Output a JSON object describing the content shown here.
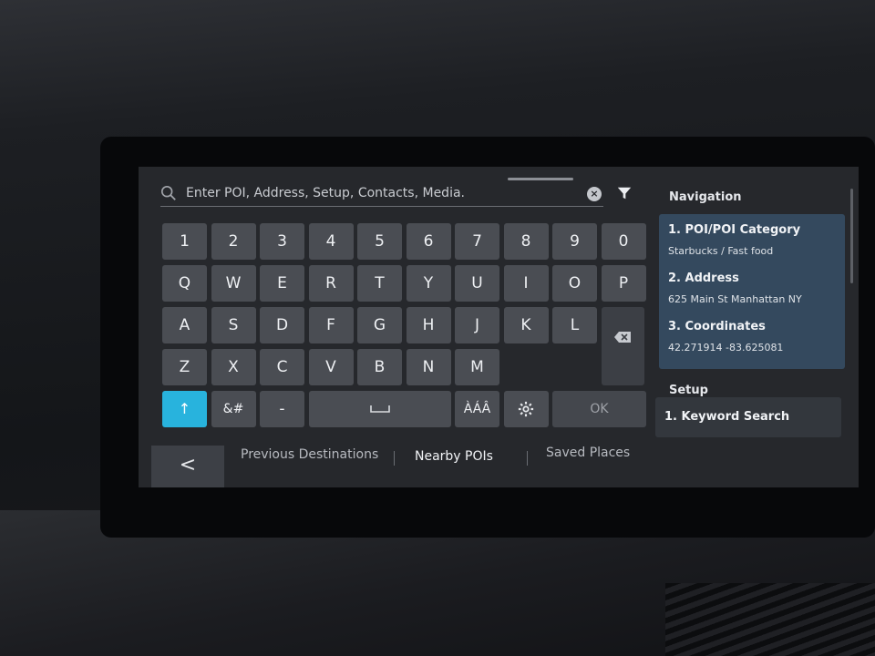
{
  "search": {
    "placeholder": "Enter POI, Address, Setup, Contacts, Media."
  },
  "icons": {
    "search": "search-icon",
    "clear": "clear-circle-icon",
    "filter": "filter-icon",
    "shift": "shift-up-arrow-icon",
    "settings": "gear-icon",
    "backspace": "backspace-icon",
    "space": "space-bar-icon",
    "back": "back-chevron-icon"
  },
  "keyboard": {
    "row1": [
      "1",
      "2",
      "3",
      "4",
      "5",
      "6",
      "7",
      "8",
      "9",
      "0"
    ],
    "row2": [
      "Q",
      "W",
      "E",
      "R",
      "T",
      "Y",
      "U",
      "I",
      "O",
      "P"
    ],
    "row3": [
      "A",
      "S",
      "D",
      "F",
      "G",
      "H",
      "J",
      "K",
      "L"
    ],
    "row4": [
      "Z",
      "X",
      "C",
      "V",
      "B",
      "N",
      "M"
    ],
    "shift": "↑",
    "symbols": "&#",
    "dash": "-",
    "accents": "ÀÁÂ",
    "ok": "OK"
  },
  "bottom_nav": {
    "back": "<",
    "tabs": [
      "Previous Destinations",
      "Nearby POIs",
      "Saved Places"
    ],
    "active_tab": "Nearby POIs"
  },
  "panel": {
    "navigation_title": "Navigation",
    "items": [
      {
        "title": "1. POI/POI Category",
        "subtitle": "Starbucks / Fast food"
      },
      {
        "title": "2. Address",
        "subtitle": "625 Main St Manhattan NY"
      },
      {
        "title": "3. Coordinates",
        "subtitle": "42.271914 -83.625081"
      }
    ],
    "setup_title": "Setup",
    "setup_items": [
      {
        "title": "1. Keyword Search"
      }
    ]
  },
  "colors": {
    "accent": "#28b3dd",
    "card": "#34495e",
    "screen_bg": "#26282c",
    "key": "#4a4d53"
  }
}
